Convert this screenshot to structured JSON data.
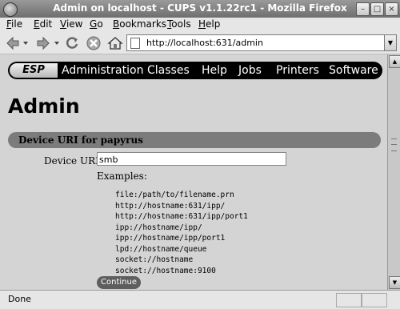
{
  "window": {
    "title": "Admin on localhost - CUPS v1.1.22rc1 - Mozilla Firefox"
  },
  "menubar": {
    "items": [
      {
        "label": "File",
        "key": "F",
        "rest": "ile"
      },
      {
        "label": "Edit",
        "key": "E",
        "rest": "dit"
      },
      {
        "label": "View",
        "key": "V",
        "rest": "iew"
      },
      {
        "label": "Go",
        "key": "G",
        "rest": "o"
      },
      {
        "label": "Bookmarks",
        "key": "B",
        "rest": "ookmarks"
      },
      {
        "label": "Tools",
        "key": "T",
        "rest": "ools"
      },
      {
        "label": "Help",
        "key": "H",
        "rest": "elp"
      }
    ]
  },
  "toolbar": {
    "url": "http://localhost:631/admin",
    "icons": [
      "back-icon",
      "forward-icon",
      "reload-icon",
      "stop-icon",
      "home-icon"
    ]
  },
  "cups_nav": {
    "logo": "ESP",
    "links": [
      "Administration",
      "Classes",
      "Help",
      "Jobs",
      "Printers",
      "Software"
    ]
  },
  "page": {
    "title": "Admin",
    "section_title": "Device URI for papyrus",
    "device_uri_label": "Device URI:",
    "device_uri_value": "smb",
    "examples_label": "Examples:",
    "examples": [
      "file:/path/to/filename.prn",
      "http://hostname:631/ipp/",
      "http://hostname:631/ipp/port1",
      "ipp://hostname/ipp/",
      "ipp://hostname/ipp/port1",
      "lpd://hostname/queue",
      "socket://hostname",
      "socket://hostname:9100"
    ],
    "continue_label": "Continue"
  },
  "status": {
    "text": "Done"
  },
  "colors": {
    "content_bg": "#d4d4d4",
    "nav_bg": "#000000",
    "section_bar": "#7c7c7c",
    "button_bg": "#5e5e5e"
  }
}
